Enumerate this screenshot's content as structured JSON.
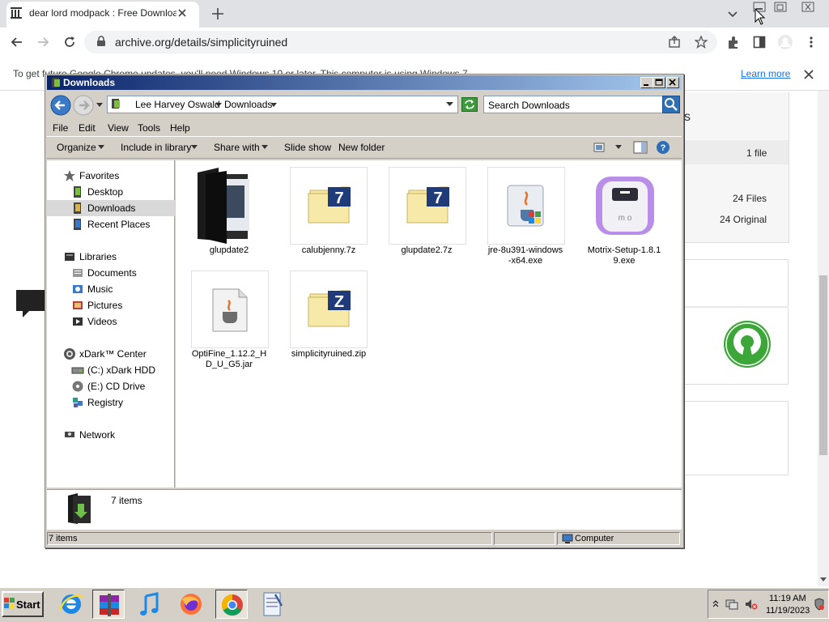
{
  "browser": {
    "tab_title": "dear lord modpack : Free Download",
    "url": "archive.org/details/simplicityruined",
    "infobar_text": "To get future Google Chrome updates, you'll need Windows 10 or later. This computer is using Windows 7.",
    "learn_more": "Learn more"
  },
  "page": {
    "card_heading": "s",
    "file_count": "1 file",
    "files_count": "24 Files",
    "original_count": "24 Original"
  },
  "explorer": {
    "title": "Downloads",
    "breadcrumbs": [
      "Lee Harvey Oswald",
      "Downloads"
    ],
    "search_placeholder": "Search Downloads",
    "menus": [
      "File",
      "Edit",
      "View",
      "Tools",
      "Help"
    ],
    "commands": [
      "Organize",
      "Include in library",
      "Share with",
      "Slide show",
      "New folder"
    ],
    "nav": {
      "favorites": "Favorites",
      "desktop": "Desktop",
      "downloads": "Downloads",
      "recent": "Recent Places",
      "libraries": "Libraries",
      "documents": "Documents",
      "music": "Music",
      "pictures": "Pictures",
      "videos": "Videos",
      "computer": "xDark™ Center",
      "c_drive": "(C:) xDark HDD",
      "e_drive": "(E:) CD Drive",
      "registry": "Registry",
      "network": "Network"
    },
    "files": [
      {
        "name": "glupdate2",
        "icon": "folder-icon"
      },
      {
        "name": "calubjenny.7z",
        "icon": "7z-archive-icon"
      },
      {
        "name": "glupdate2.7z",
        "icon": "7z-archive-icon"
      },
      {
        "name": "jre-8u391-windows-x64.exe",
        "line1": "jre-8u391-windows",
        "line2": "-x64.exe",
        "icon": "java-installer-icon"
      },
      {
        "name": "Motrix-Setup-1.8.19.exe",
        "line1": "Motrix-Setup-1.8.1",
        "line2": "9.exe",
        "icon": "motrix-icon"
      },
      {
        "name": "OptiFine_1.12.2_HD_U_G5.jar",
        "line1": "OptiFine_1.12.2_H",
        "line2": "D_U_G5.jar",
        "icon": "jar-file-icon"
      },
      {
        "name": "simplicityruined.zip",
        "icon": "zip-archive-icon"
      }
    ],
    "details_count": "7 items",
    "status_items": "7 items",
    "status_location": "Computer"
  },
  "taskbar": {
    "start": "Start",
    "time": "11:19 AM",
    "date": "11/19/2023",
    "apps": [
      "internet-explorer-icon",
      "winrar-icon",
      "music-icon",
      "firefox-icon",
      "chrome-icon",
      "notepad-icon"
    ]
  },
  "colors": {
    "titlebar_start": "#0a246a",
    "titlebar_end": "#a6caf0",
    "chrome_tabbar": "#dfe1e5",
    "link": "#1a73e8",
    "osi_green": "#3da639"
  }
}
